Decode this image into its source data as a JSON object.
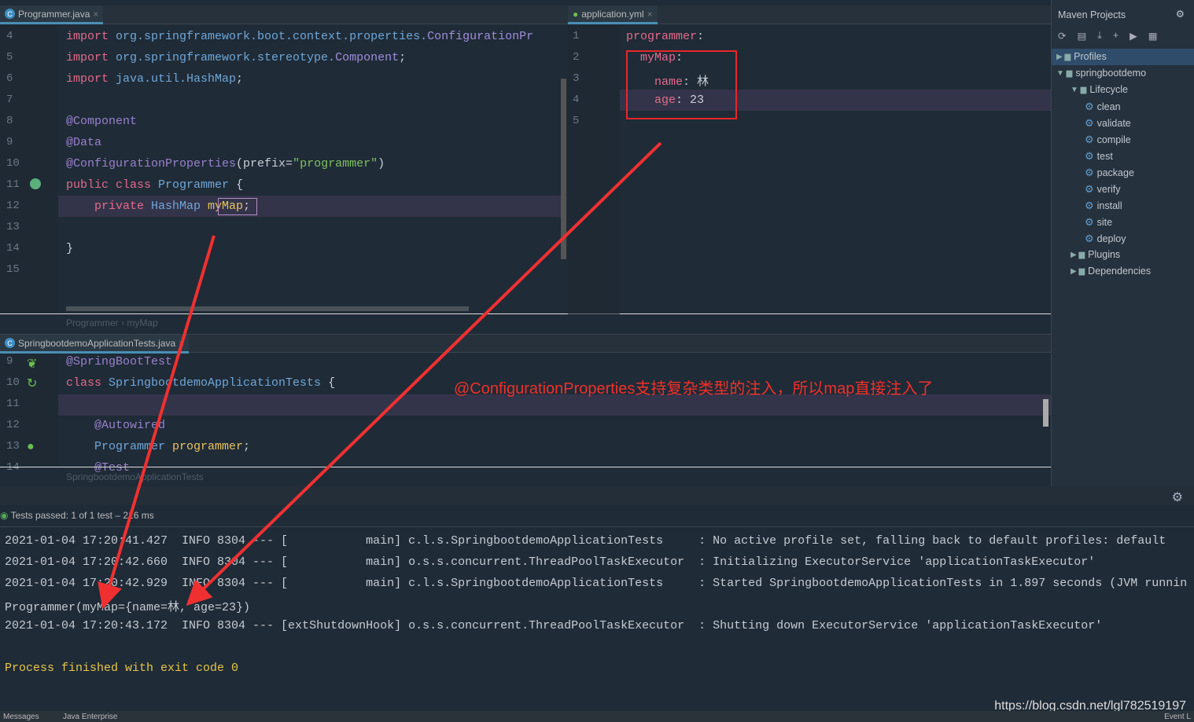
{
  "editor_top": {
    "tab": "Programmer.java",
    "lines": [
      {
        "n": "4",
        "parts": [
          [
            "kw",
            "import "
          ],
          [
            "id",
            "org.springframework.boot.context.properties."
          ],
          [
            "cl",
            "ConfigurationPr"
          ]
        ]
      },
      {
        "n": "5",
        "parts": [
          [
            "kw",
            "import "
          ],
          [
            "id",
            "org.springframework.stereotype."
          ],
          [
            "cl",
            "Component"
          ],
          [
            "pl",
            ";"
          ]
        ]
      },
      {
        "n": "6",
        "parts": [
          [
            "kw",
            "import "
          ],
          [
            "id",
            "java.util.HashMap"
          ],
          [
            "pl",
            ";"
          ]
        ]
      },
      {
        "n": "7",
        "parts": []
      },
      {
        "n": "8",
        "parts": [
          [
            "an",
            "@Component"
          ]
        ]
      },
      {
        "n": "9",
        "parts": [
          [
            "an",
            "@Data"
          ]
        ]
      },
      {
        "n": "10",
        "parts": [
          [
            "an",
            "@ConfigurationProperties"
          ],
          [
            "pl",
            "(prefix="
          ],
          [
            "st",
            "\"programmer\""
          ],
          [
            "pl",
            ")"
          ]
        ]
      },
      {
        "n": "11",
        "parts": [
          [
            "kw",
            "public class "
          ],
          [
            "id",
            "Programmer "
          ],
          [
            "pl",
            "{"
          ]
        ]
      },
      {
        "n": "12",
        "parts": [
          [
            "kw",
            "    private "
          ],
          [
            "id",
            "HashMap "
          ],
          [
            "fd",
            "myMap"
          ],
          [
            "pl",
            ";"
          ]
        ]
      },
      {
        "n": "13",
        "parts": []
      },
      {
        "n": "14",
        "parts": [
          [
            "pl",
            "}"
          ]
        ]
      },
      {
        "n": "15",
        "parts": []
      }
    ],
    "breadcrumb": [
      "Programmer",
      "myMap"
    ]
  },
  "yaml": {
    "tab": "application.yml",
    "lines": [
      {
        "n": "1",
        "parts": [
          [
            "kw",
            "programmer"
          ],
          [
            "pl",
            ":"
          ]
        ]
      },
      {
        "n": "2",
        "parts": [
          [
            "kw",
            "  myMap"
          ],
          [
            "pl",
            ":"
          ]
        ]
      },
      {
        "n": "3",
        "parts": [
          [
            "kw",
            "    name"
          ],
          [
            "pl",
            ": 林"
          ]
        ]
      },
      {
        "n": "4",
        "parts": [
          [
            "kw",
            "    age"
          ],
          [
            "pl",
            ": 23"
          ]
        ]
      },
      {
        "n": "5",
        "parts": []
      }
    ]
  },
  "maven": {
    "title": "Maven Projects",
    "items": [
      "Profiles",
      "springbootdemo",
      "Lifecycle",
      "clean",
      "validate",
      "compile",
      "test",
      "package",
      "verify",
      "install",
      "site",
      "deploy",
      "Plugins",
      "Dependencies"
    ]
  },
  "editor_bottom": {
    "tab": "SpringbootdemoApplicationTests.java",
    "lines": [
      {
        "n": "9",
        "parts": [
          [
            "an",
            "@SpringBootTest"
          ]
        ]
      },
      {
        "n": "10",
        "parts": [
          [
            "kw",
            "class "
          ],
          [
            "id",
            "SpringbootdemoApplicationTests "
          ],
          [
            "pl",
            "{"
          ]
        ]
      },
      {
        "n": "11",
        "parts": []
      },
      {
        "n": "12",
        "parts": [
          [
            "an",
            "    @Autowired"
          ]
        ]
      },
      {
        "n": "13",
        "parts": [
          [
            "id",
            "    Programmer "
          ],
          [
            "fd",
            "programmer"
          ],
          [
            "pl",
            ";"
          ]
        ]
      },
      {
        "n": "14",
        "parts": [
          [
            "an",
            "    @Test"
          ]
        ]
      }
    ],
    "breadcrumb": "SpringbootdemoApplicationTests"
  },
  "annotation": "@ConfigurationProperties支持复杂类型的注入，所以map直接注入了",
  "run": {
    "status": "Tests passed: 1 of 1 test – 216 ms",
    "log": [
      "2021-01-04 17:20:41.427  INFO 8304 --- [           main] c.l.s.SpringbootdemoApplicationTests     : No active profile set, falling back to default profiles: default",
      "2021-01-04 17:20:42.660  INFO 8304 --- [           main] o.s.s.concurrent.ThreadPoolTaskExecutor  : Initializing ExecutorService 'applicationTaskExecutor'",
      "2021-01-04 17:20:42.929  INFO 8304 --- [           main] c.l.s.SpringbootdemoApplicationTests     : Started SpringbootdemoApplicationTests in 1.897 seconds (JVM runnin",
      "Programmer(myMap={name=林, age=23})",
      "2021-01-04 17:20:43.172  INFO 8304 --- [extShutdownHook] o.s.s.concurrent.ThreadPoolTaskExecutor  : Shutting down ExecutorService 'applicationTaskExecutor'",
      "",
      "Process finished with exit code 0"
    ]
  },
  "watermark": "https://blog.csdn.net/lgl782519197",
  "statusbar": {
    "left": [
      "Messages",
      "Java Enterprise"
    ],
    "right": "Event L"
  }
}
